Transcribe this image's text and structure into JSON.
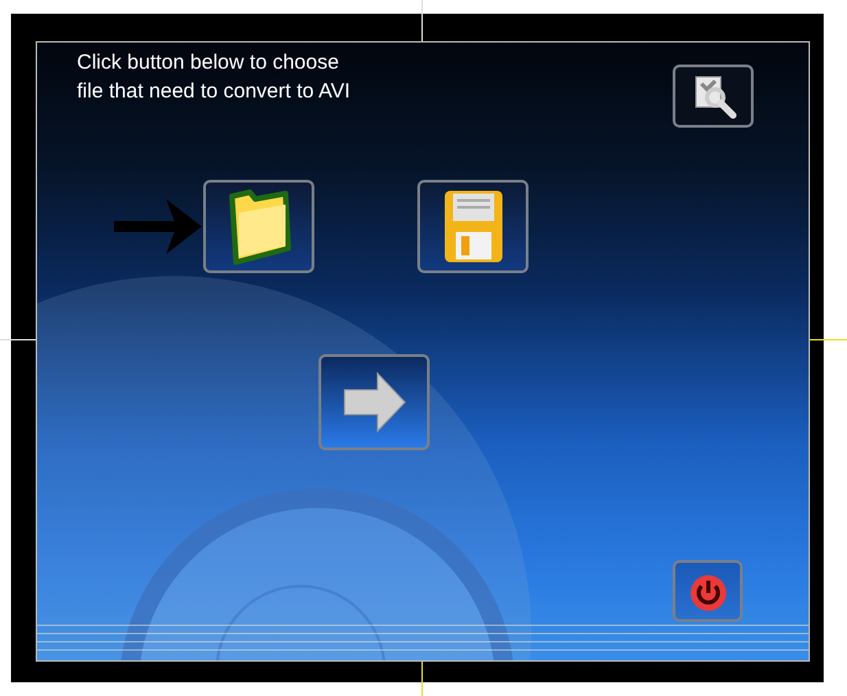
{
  "instruction_lines": [
    "Click button below to choose",
    "file that need to convert to AVI"
  ]
}
